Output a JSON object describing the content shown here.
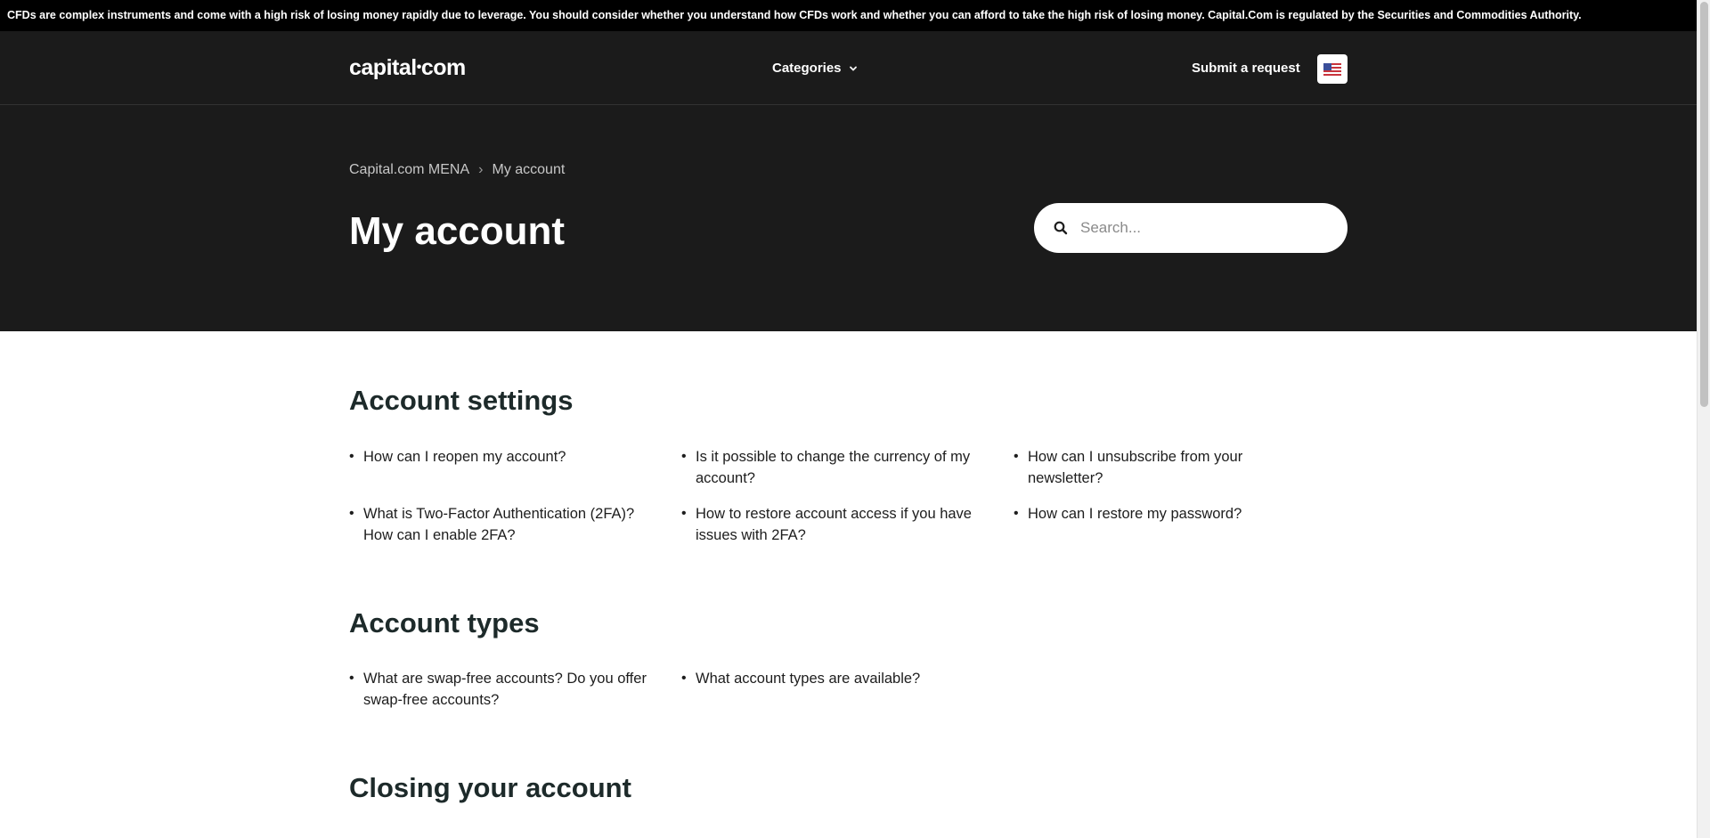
{
  "risk_warning": "CFDs are complex instruments and come with a high risk of losing money rapidly due to leverage. You should consider whether you understand how CFDs work and whether you can afford to take the high risk of losing money. Capital.Com is regulated by the Securities and Commodities Authority.",
  "header": {
    "logo_left": "capital",
    "logo_dot": "•",
    "logo_right": "com",
    "categories_label": "Categories",
    "submit_request_label": "Submit a request",
    "language_icon": "us-flag-icon"
  },
  "breadcrumb": {
    "root": "Capital.com MENA",
    "separator": "›",
    "current": "My account"
  },
  "page_title": "My account",
  "search": {
    "placeholder": "Search..."
  },
  "sections": [
    {
      "title": "Account settings",
      "articles": [
        "How can I reopen my account?",
        "Is it possible to change the currency of my account?",
        "How can I unsubscribe from your newsletter?",
        "What is Two-Factor Authentication (2FA)? How can I enable 2FA?",
        "How to restore account access if you have issues with 2FA?",
        "How can I restore my password?"
      ]
    },
    {
      "title": "Account types",
      "articles": [
        "What are swap-free accounts? Do you offer swap-free accounts?",
        "What account types are available?"
      ]
    },
    {
      "title": "Closing your account",
      "articles": []
    }
  ]
}
